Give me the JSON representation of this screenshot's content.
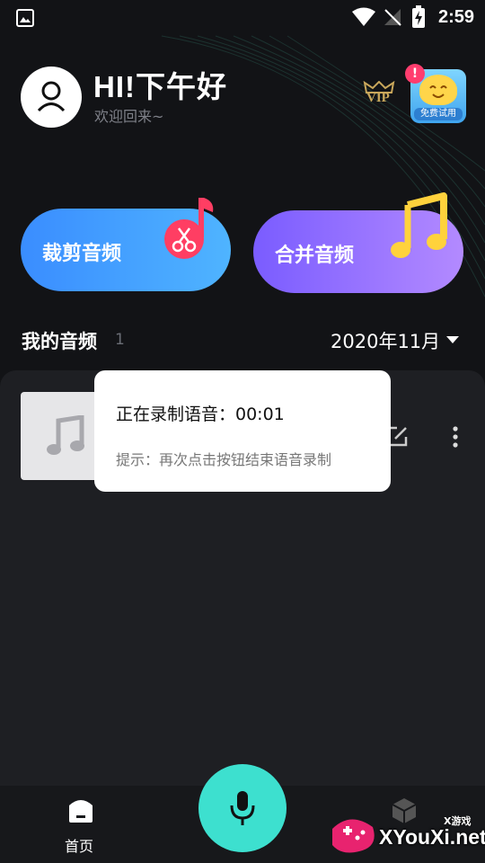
{
  "status_bar": {
    "time": "2:59"
  },
  "header": {
    "greeting": "HI!下午好",
    "subtitle": "欢迎回来~",
    "vip_label": "VIP",
    "trial_label": "免费试用",
    "trial_badge": "!"
  },
  "actions": {
    "cut_label": "裁剪音频",
    "merge_label": "合并音频"
  },
  "section": {
    "title": "我的音频",
    "count": "1",
    "month": "2020年11月"
  },
  "dialog": {
    "title": "正在录制语音：00:01",
    "hint": "提示：再次点击按钮结束语音录制"
  },
  "bottom_nav": {
    "home_label": "首页"
  },
  "watermark": {
    "site": "XYouXi.net",
    "small": "X游戏"
  },
  "colors": {
    "cut_button": "#3a8dff",
    "merge_button": "#9b74ff",
    "mic_button": "#3de0cf",
    "background": "#121316"
  }
}
